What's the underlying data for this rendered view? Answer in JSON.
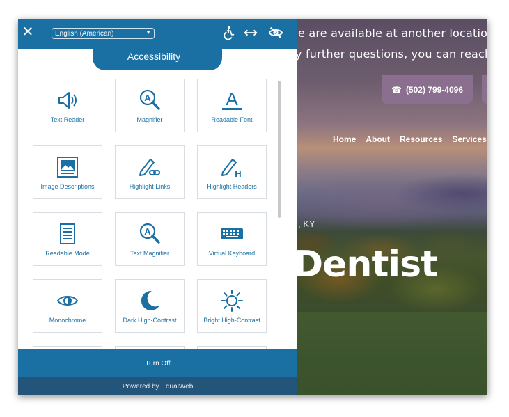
{
  "website": {
    "banner_line1": "e are available at another location or",
    "banner_line2": "y further questions, you can reach us",
    "phone": "(502) 799-4096",
    "nav": [
      "Home",
      "About",
      "Resources",
      "Services"
    ],
    "location_fragment": ", KY",
    "hero_title": "Dentist"
  },
  "panel": {
    "close_glyph": "✕",
    "language": "English (American)",
    "title": "Accessibility",
    "accent_color": "#1a6fa3",
    "tiles": [
      {
        "label": "Text Reader",
        "icon": "speaker-icon"
      },
      {
        "label": "Magnifier",
        "icon": "magnifier-icon"
      },
      {
        "label": "Readable Font",
        "icon": "readable-font-icon"
      },
      {
        "label": "Image Descriptions",
        "icon": "image-icon"
      },
      {
        "label": "Highlight Links",
        "icon": "highlight-links-icon"
      },
      {
        "label": "Highlight Headers",
        "icon": "highlight-headers-icon"
      },
      {
        "label": "Readable Mode",
        "icon": "document-icon"
      },
      {
        "label": "Text Magnifier",
        "icon": "text-magnifier-icon"
      },
      {
        "label": "Virtual Keyboard",
        "icon": "keyboard-icon"
      },
      {
        "label": "Monochrome",
        "icon": "eye-icon"
      },
      {
        "label": "Dark High-Contrast",
        "icon": "moon-icon"
      },
      {
        "label": "Bright High-Contrast",
        "icon": "sun-icon"
      }
    ],
    "turn_off": "Turn Off",
    "powered_by": "Powered by EqualWeb"
  }
}
